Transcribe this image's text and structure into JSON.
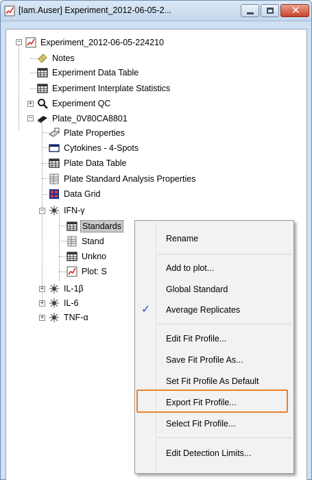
{
  "window": {
    "title": "[Iam.Auser] Experiment_2012-06-05-2...",
    "close_glyph": "✕"
  },
  "tree": {
    "root": "Experiment_2012-06-05-224210",
    "notes": "Notes",
    "experiment_data_table": "Experiment Data Table",
    "experiment_interplate_statistics": "Experiment Interplate Statistics",
    "experiment_qc": "Experiment QC",
    "plate": "Plate_0V80CA8801",
    "plate_properties": "Plate Properties",
    "cytokines": "Cytokines - 4-Spots",
    "plate_data_table": "Plate Data Table",
    "plate_standard_analysis_properties": "Plate Standard Analysis Properties",
    "data_grid": "Data Grid",
    "ifn": "IFN-γ",
    "standards": "Standards",
    "stand_partial": "Stand",
    "unkno_partial": "Unkno",
    "plot_partial": "Plot: S",
    "il1b": "IL-1β",
    "il6": "IL-6",
    "tnf": "TNF-α",
    "expand_plus": "+",
    "collapse_minus": "−"
  },
  "context_menu": {
    "rename": "Rename",
    "add_to_plot": "Add to plot...",
    "global_standard": "Global Standard",
    "average_replicates": "Average Replicates",
    "average_replicates_checked": "✓",
    "edit_fit_profile": "Edit Fit Profile...",
    "save_fit_profile_as": "Save Fit Profile As...",
    "set_fit_profile_default": "Set Fit Profile As Default",
    "export_fit_profile": "Export Fit Profile...",
    "select_fit_profile": "Select Fit Profile...",
    "edit_detection_limits": "Edit Detection Limits..."
  },
  "colors": {
    "highlight_outline": "#e8812a",
    "check_mark": "#1f55c4",
    "close_button": "#c7452a"
  }
}
